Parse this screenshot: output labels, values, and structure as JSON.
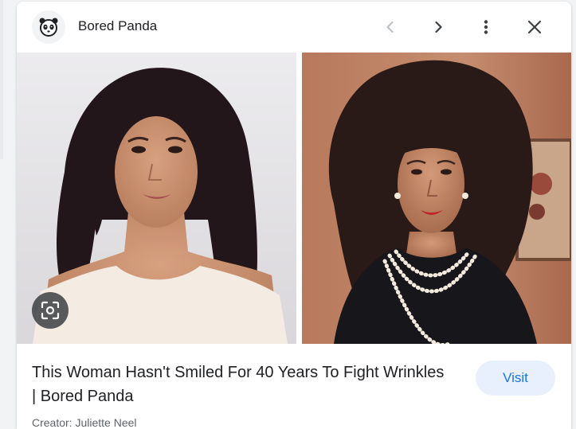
{
  "header": {
    "site_name": "Bored Panda",
    "favicon_icon": "panda-icon",
    "prev_icon": "chevron-left-icon",
    "next_icon": "chevron-right-icon",
    "more_icon": "more-vert-icon",
    "close_icon": "close-icon"
  },
  "images": {
    "left_image": "woman-portrait-now-image",
    "right_image": "woman-portrait-vintage-image",
    "lens_icon": "google-lens-icon"
  },
  "result": {
    "title": "This Woman Hasn't Smiled For 40 Years To Fight Wrinkles | Bored Panda",
    "visit_label": "Visit",
    "creator": "Creator: Juliette Neel"
  },
  "colors": {
    "accent": "#1a73e8",
    "visit_bg": "#e8f0fe",
    "text_primary": "#202124",
    "text_secondary": "#5f6368"
  }
}
